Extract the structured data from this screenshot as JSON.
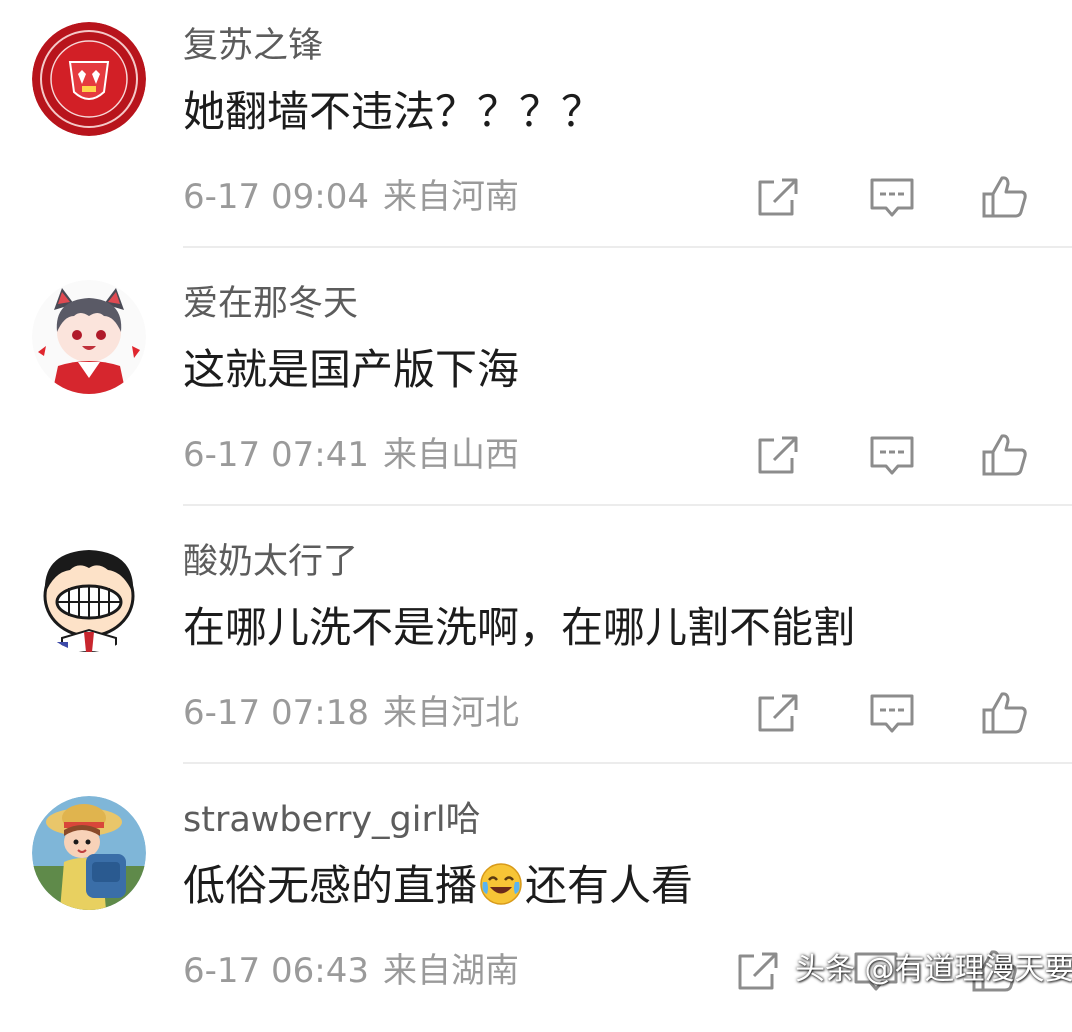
{
  "comments": [
    {
      "username": "复苏之锋",
      "content": "她翻墙不违法？？？？",
      "time": "6-17 09:04",
      "location": "来自河南",
      "avatar": "manchester-united-crest-icon"
    },
    {
      "username": "爱在那冬天",
      "content": "这就是国产版下海",
      "time": "6-17 07:41",
      "location": "来自山西",
      "avatar": "anime-character-avatar"
    },
    {
      "username": "酸奶太行了",
      "content": "在哪儿洗不是洗啊，在哪儿割不能割",
      "time": "6-17 07:18",
      "location": "来自河北",
      "avatar": "cartoon-boy-avatar"
    },
    {
      "username": "strawberry_girl哈",
      "content_before": "低俗无感的直播",
      "content_emoji": "laughing-crying-emoji",
      "content_after": "还有人看",
      "time": "6-17 06:43",
      "location": "来自湖南",
      "avatar": "cartoon-girl-avatar"
    }
  ],
  "icons": {
    "share": "share-icon",
    "reply": "reply-icon",
    "like": "thumbs-up-icon"
  },
  "watermark": "头条 @有道理漫天要",
  "colors": {
    "username": "#5c5c5c",
    "content": "#1c1c1c",
    "meta": "#9a9a9a",
    "icon": "#8c8c8c",
    "divider": "#ececec"
  }
}
